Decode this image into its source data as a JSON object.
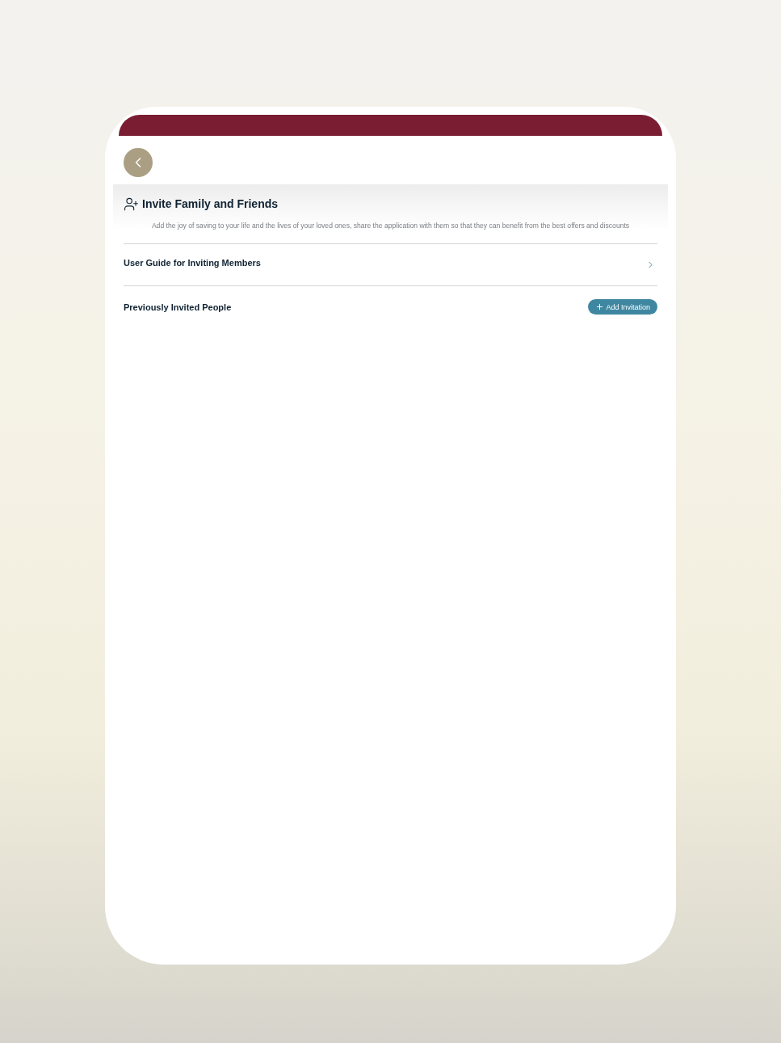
{
  "page": {
    "title": "Invite Family and Friends",
    "description": "Add the joy of saving to your life and the lives of your loved ones, share the application with them so that they can benefit from the best offers and discounts"
  },
  "menu_items": [
    {
      "label": "User Guide for Inviting Members"
    }
  ],
  "invited_section": {
    "title": "Previously Invited People",
    "add_button": "Add Invitation"
  }
}
